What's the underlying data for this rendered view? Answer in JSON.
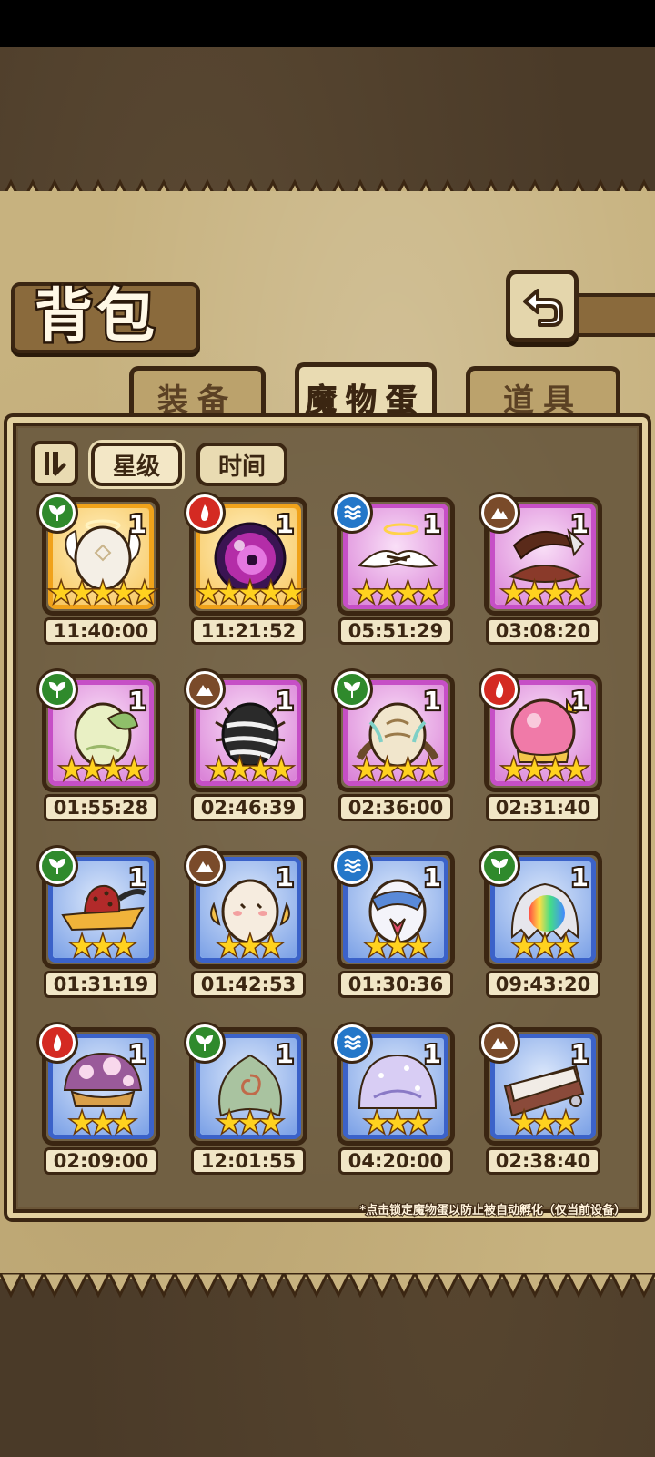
{
  "title": "背包",
  "tabs": [
    "装备",
    "魔物蛋",
    "道具"
  ],
  "active_tab": "魔物蛋",
  "filters": [
    "星级",
    "时间"
  ],
  "active_filter": "星级",
  "note": "*点击锁定魔物蛋以防止被自动孵化（仅当前设备）",
  "eggs": [
    {
      "element": "grass",
      "frame": "gold",
      "qty": "1",
      "stars": 5,
      "stars_text": "★★★★★",
      "timer": "11:40:00",
      "art": "angel-white"
    },
    {
      "element": "fire",
      "frame": "gold",
      "qty": "1",
      "stars": 5,
      "stars_text": "★★★★★",
      "timer": "11:21:52",
      "art": "dark-orb"
    },
    {
      "element": "water",
      "frame": "purple",
      "qty": "1",
      "stars": 4,
      "stars_text": "★★★★",
      "timer": "05:51:29",
      "art": "halo-wings"
    },
    {
      "element": "earth",
      "frame": "purple",
      "qty": "1",
      "stars": 4,
      "stars_text": "★★★★",
      "timer": "03:08:20",
      "art": "horn-nest"
    },
    {
      "element": "grass",
      "frame": "purple",
      "qty": "1",
      "stars": 4,
      "stars_text": "★★★★",
      "timer": "01:55:28",
      "art": "leaf-egg"
    },
    {
      "element": "earth",
      "frame": "purple",
      "qty": "1",
      "stars": 4,
      "stars_text": "★★★★",
      "timer": "02:46:39",
      "art": "spider-egg"
    },
    {
      "element": "grass",
      "frame": "purple",
      "qty": "1",
      "stars": 4,
      "stars_text": "★★★★",
      "timer": "02:36:00",
      "art": "feather-egg"
    },
    {
      "element": "fire",
      "frame": "purple",
      "qty": "1",
      "stars": 4,
      "stars_text": "★★★★",
      "timer": "02:31:40",
      "art": "crown-egg"
    },
    {
      "element": "grass",
      "frame": "blue",
      "qty": "1",
      "stars": 3,
      "stars_text": "★★★",
      "timer": "01:31:19",
      "art": "strawberry-hat"
    },
    {
      "element": "earth",
      "frame": "blue",
      "qty": "1",
      "stars": 3,
      "stars_text": "★★★",
      "timer": "01:42:53",
      "art": "fluffy-egg"
    },
    {
      "element": "water",
      "frame": "blue",
      "qty": "1",
      "stars": 3,
      "stars_text": "★★★",
      "timer": "01:30:36",
      "art": "sailor-egg"
    },
    {
      "element": "grass",
      "frame": "blue",
      "qty": "1",
      "stars": 3,
      "stars_text": "★★★",
      "timer": "09:43:20",
      "art": "rainbow-slime"
    },
    {
      "element": "fire",
      "frame": "blue",
      "qty": "1",
      "stars": 3,
      "stars_text": "★★★",
      "timer": "02:09:00",
      "art": "mushroom-egg"
    },
    {
      "element": "grass",
      "frame": "blue",
      "qty": "1",
      "stars": 3,
      "stars_text": "★★★",
      "timer": "12:01:55",
      "art": "leaf-swirl"
    },
    {
      "element": "water",
      "frame": "blue",
      "qty": "1",
      "stars": 3,
      "stars_text": "★★★",
      "timer": "04:20:00",
      "art": "jelly-egg"
    },
    {
      "element": "earth",
      "frame": "blue",
      "qty": "1",
      "stars": 3,
      "stars_text": "★★★",
      "timer": "02:38:40",
      "art": "book-egg"
    }
  ]
}
